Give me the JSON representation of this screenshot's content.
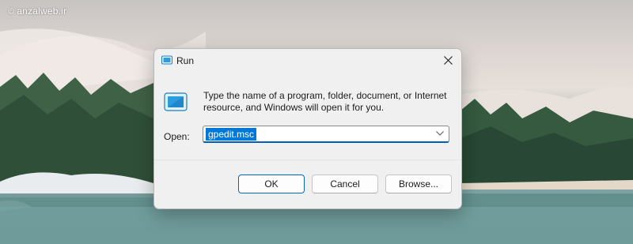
{
  "watermark": {
    "text": "anzalweb.ir",
    "symbol": "©"
  },
  "dialog": {
    "title": "Run",
    "description": "Type the name of a program, folder, document, or Internet resource, and Windows will open it for you.",
    "open_label": "Open:",
    "open_value": "gpedit.msc",
    "buttons": {
      "ok": "OK",
      "cancel": "Cancel",
      "browse": "Browse..."
    },
    "icons": {
      "title": "run-icon",
      "close": "close-icon",
      "dropdown": "chevron-down-icon",
      "main": "run-large-icon"
    }
  },
  "colors": {
    "accent": "#005fb8",
    "selection": "#0078d7",
    "dialog_bg": "#f0f0f0"
  }
}
